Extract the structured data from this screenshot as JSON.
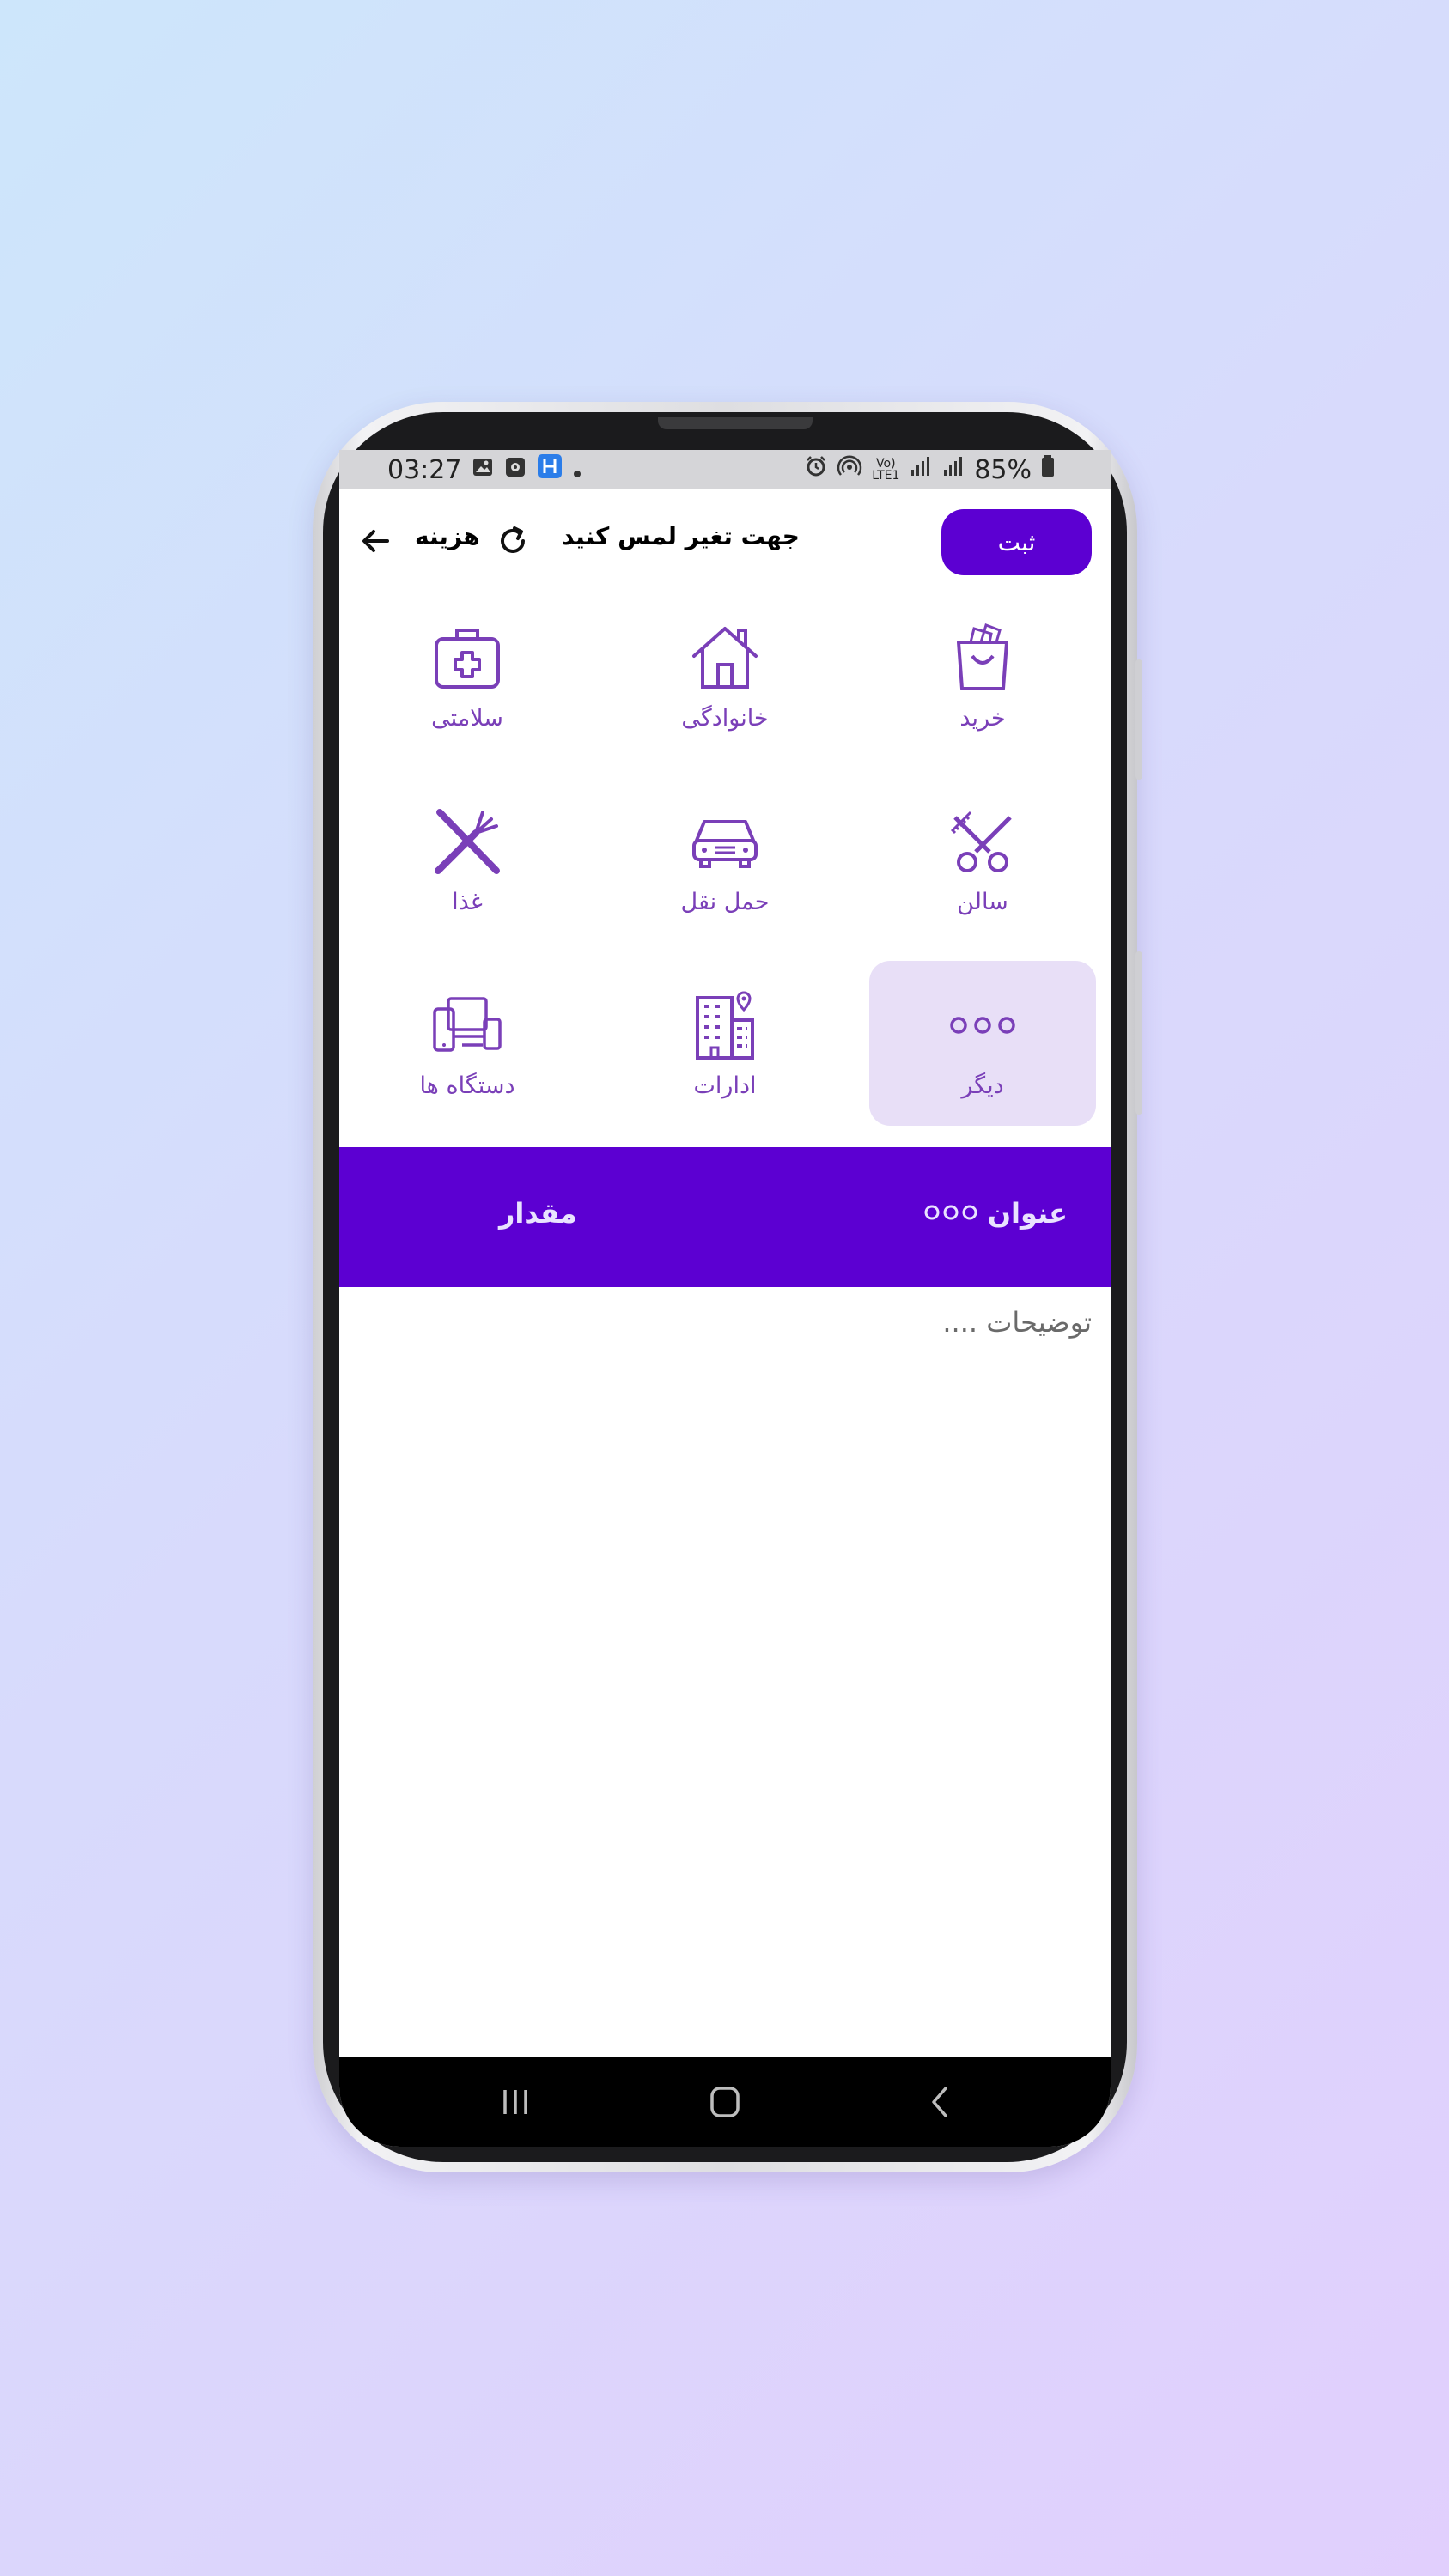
{
  "status_bar": {
    "time": "03:27",
    "battery": "85%",
    "left_icons": [
      "gallery-icon",
      "app-icon",
      "app-h-icon",
      "dot-icon"
    ],
    "right_icons": [
      "alarm-icon",
      "hotspot-icon",
      "volte-icon",
      "signal-icon",
      "signal-icon",
      "battery-icon"
    ],
    "volte_label": "Vo) LTE1"
  },
  "toolbar": {
    "submit_label": "ثبت",
    "hint": "جهت تغیر لمس کنید",
    "kind": "هزینه"
  },
  "categories": [
    {
      "label": "خرید",
      "icon": "shopping-bag-icon"
    },
    {
      "label": "خانوادگی",
      "icon": "house-icon"
    },
    {
      "label": "سلامتی",
      "icon": "first-aid-kit-icon"
    },
    {
      "label": "سالن",
      "icon": "scissors-comb-icon"
    },
    {
      "label": "حمل نقل",
      "icon": "car-icon"
    },
    {
      "label": "غذا",
      "icon": "fork-knife-icon"
    },
    {
      "label": "دیگر",
      "icon": "more-dots-icon",
      "selected": true
    },
    {
      "label": "ادارات",
      "icon": "office-building-icon"
    },
    {
      "label": "دستگاه ها",
      "icon": "devices-icon"
    }
  ],
  "entry": {
    "title_label": "عنوان",
    "amount_label": "مقدار"
  },
  "description": {
    "placeholder": "توضیحات ...."
  },
  "colors": {
    "primary": "#5c00d2",
    "icon": "#7a3fb8",
    "selected_bg": "#e8dff7"
  }
}
